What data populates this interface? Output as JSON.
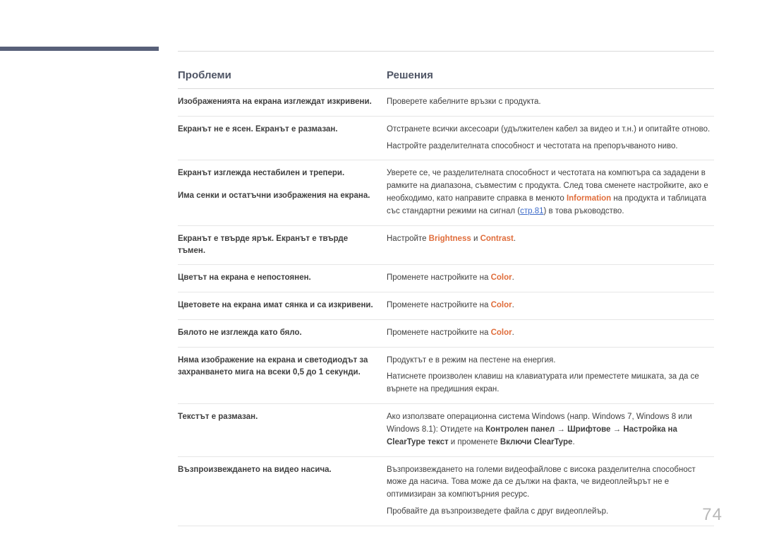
{
  "header": {
    "col1": "Проблеми",
    "col2": "Решения"
  },
  "rows": [
    {
      "problem": "Изображенията на екрана изглеждат изкривени.",
      "solution": [
        {
          "t": "Проверете кабелните връзки с продукта."
        }
      ]
    },
    {
      "problem": "Екранът не е ясен. Екранът е размазан.",
      "solution": [
        {
          "t": "Отстранете всички аксесоари (удължителен кабел за видео и т.н.) и опитайте отново."
        },
        {
          "t": "Настройте разделителната способност и честотата на препоръчваното ниво."
        }
      ]
    },
    {
      "problem_multi": [
        "Екранът изглежда нестабилен и трепери.",
        "Има сенки и остатъчни изображения на екрана."
      ],
      "solution": [
        {
          "parts": [
            {
              "t": "Уверете се, че разделителната способност и честотата на компютъра са зададени в рамките на диапазона, съвместим с продукта. След това сменете настройките, ако е необходимо, като направите справка в менюто "
            },
            {
              "t": "Information",
              "cls": "accent"
            },
            {
              "t": " на продукта и таблицата със стандартни режими на сигнал ("
            },
            {
              "t": "стр.81",
              "cls": "link"
            },
            {
              "t": ") в това ръководство."
            }
          ]
        }
      ]
    },
    {
      "problem": "Екранът е твърде ярък. Екранът е твърде тъмен.",
      "solution": [
        {
          "parts": [
            {
              "t": "Настройте "
            },
            {
              "t": "Brightness",
              "cls": "accent"
            },
            {
              "t": " и "
            },
            {
              "t": "Contrast",
              "cls": "accent"
            },
            {
              "t": "."
            }
          ]
        }
      ]
    },
    {
      "problem": "Цветът на екрана е непостоянен.",
      "solution": [
        {
          "parts": [
            {
              "t": "Променете настройките на "
            },
            {
              "t": "Color",
              "cls": "accent"
            },
            {
              "t": "."
            }
          ]
        }
      ]
    },
    {
      "problem": "Цветовете на екрана имат сянка и са изкривени.",
      "solution": [
        {
          "parts": [
            {
              "t": "Променете настройките на "
            },
            {
              "t": "Color",
              "cls": "accent"
            },
            {
              "t": "."
            }
          ]
        }
      ]
    },
    {
      "problem": "Бялото не изглежда като бяло.",
      "solution": [
        {
          "parts": [
            {
              "t": "Променете настройките на "
            },
            {
              "t": "Color",
              "cls": "accent"
            },
            {
              "t": "."
            }
          ]
        }
      ]
    },
    {
      "problem": "Няма изображение на екрана и светодиодът за захранването мига на всеки 0,5 до 1 секунди.",
      "solution": [
        {
          "t": "Продуктът е в режим на пестене на енергия."
        },
        {
          "t": "Натиснете произволен клавиш на клавиатурата или преместете мишката, за да се върнете на предишния екран."
        }
      ]
    },
    {
      "problem": "Текстът е размазан.",
      "solution": [
        {
          "parts": [
            {
              "t": "Ако използвате операционна система Windows (напр. Windows 7, Windows 8 или Windows 8.1): Отидете на "
            },
            {
              "t": "Контролен панел",
              "cls": "b"
            },
            {
              "t": " → "
            },
            {
              "t": "Шрифтове",
              "cls": "b"
            },
            {
              "t": " → "
            },
            {
              "t": "Настройка на ClearType текст",
              "cls": "b"
            },
            {
              "t": " и променете "
            },
            {
              "t": "Включи ClearType",
              "cls": "b"
            },
            {
              "t": "."
            }
          ]
        }
      ]
    },
    {
      "problem": "Възпроизвеждането на видео насича.",
      "solution": [
        {
          "t": "Възпроизвеждането на големи видеофайлове с висока разделителна способност може да насича. Това може да се дължи на факта, че видеоплейърът не е оптимизиран за компютърния ресурс."
        },
        {
          "t": "Пробвайте да възпроизведете файла с друг видеоплейър."
        }
      ]
    }
  ],
  "page_number": "74"
}
